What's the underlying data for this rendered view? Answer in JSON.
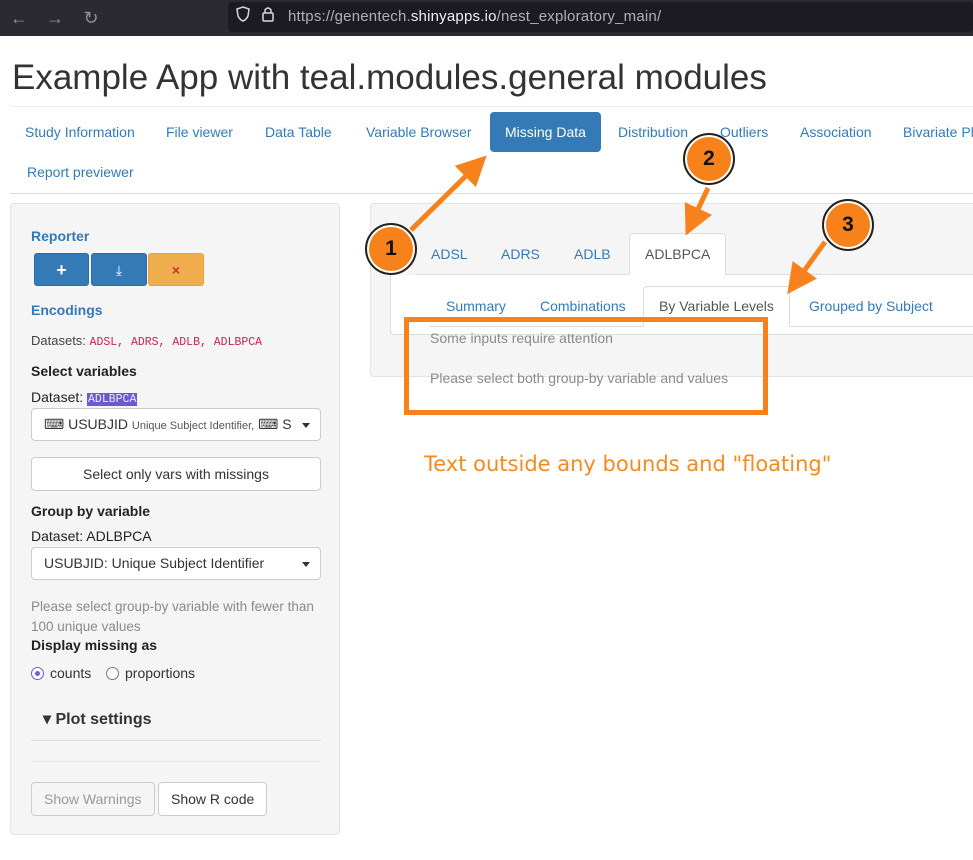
{
  "browser": {
    "url_prefix": "https://genentech.",
    "url_domain": "shinyapps.io",
    "url_path": "/nest_exploratory_main/"
  },
  "app": {
    "title": "Example App with teal.modules.general modules",
    "tabs": [
      {
        "label": "Study Information"
      },
      {
        "label": "File viewer"
      },
      {
        "label": "Data Table"
      },
      {
        "label": "Variable Browser"
      },
      {
        "label": "Missing Data",
        "active": true
      },
      {
        "label": "Distribution"
      },
      {
        "label": "Outliers"
      },
      {
        "label": "Association"
      },
      {
        "label": "Bivariate Pl"
      },
      {
        "label": "Report previewer"
      }
    ]
  },
  "sidebar": {
    "reporter_label": "Reporter",
    "reporter_buttons": {
      "add": "+",
      "download": "⤓",
      "reset": "×"
    },
    "encodings_label": "Encodings",
    "datasets_prefix": "Datasets:",
    "datasets_list": "ADSL, ADRS, ADLB, ADLBPCA",
    "select_variables_label": "Select variables",
    "dataset_prefix": "Dataset:",
    "dataset_value": "ADLBPCA",
    "select_value_main": "⌨ USUBJID",
    "select_value_small": "Unique Subject Identifier,",
    "select_value_tail": "⌨ S",
    "select_missings_button": "Select only vars with missings",
    "group_by_label": "Group by variable",
    "group_dataset": "Dataset: ADLBPCA",
    "group_select_value": "USUBJID: Unique Subject Identifier",
    "group_help": "Please select group-by variable with fewer than 100 unique values",
    "display_missing_label": "Display missing as",
    "radio_counts": "counts",
    "radio_proportions": "proportions",
    "plot_settings": "Plot settings",
    "show_warnings": "Show Warnings",
    "show_r_code": "Show R code"
  },
  "main": {
    "dataset_tabs": [
      {
        "label": "ADSL"
      },
      {
        "label": "ADRS"
      },
      {
        "label": "ADLB"
      },
      {
        "label": "ADLBPCA",
        "active": true
      }
    ],
    "sub_tabs": [
      {
        "label": "Summary"
      },
      {
        "label": "Combinations"
      },
      {
        "label": "By Variable Levels",
        "active": true
      },
      {
        "label": "Grouped by Subject"
      }
    ],
    "warning_title": "Some inputs require attention",
    "warning_message": "Please select both group-by variable and values"
  },
  "annotations": {
    "floating_text": "Text outside any bounds and \"floating\"",
    "badges": [
      "1",
      "2",
      "3"
    ],
    "accent_color": "#f7821b"
  }
}
